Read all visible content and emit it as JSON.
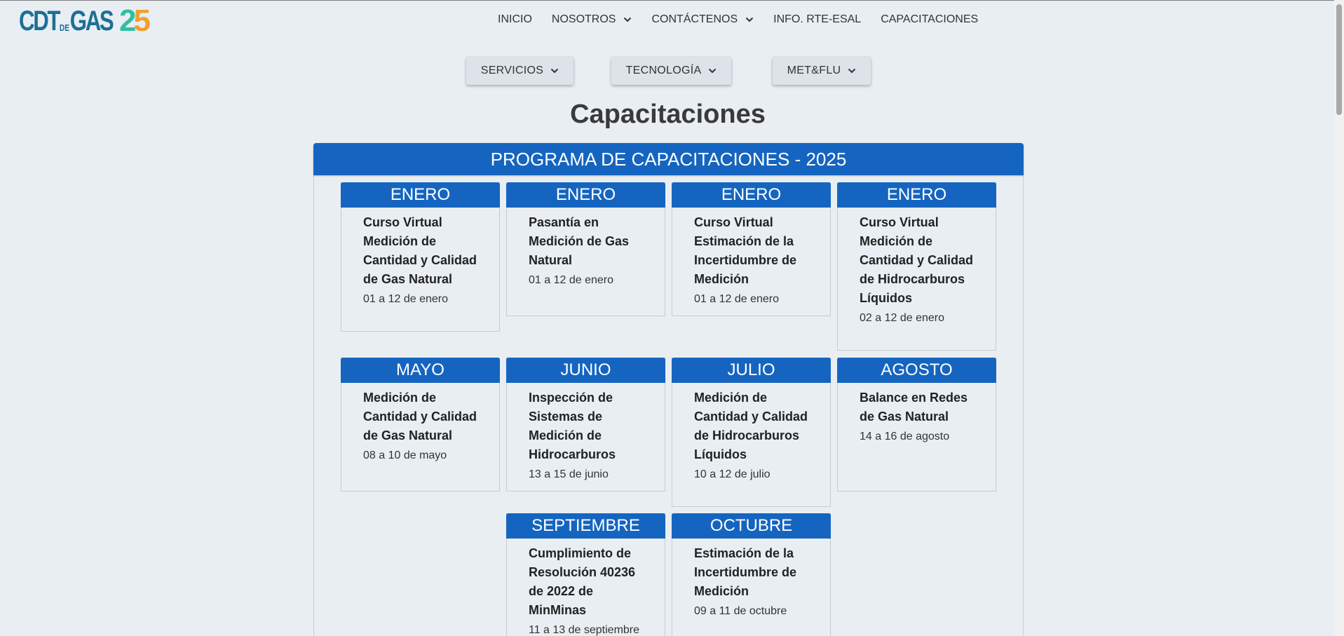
{
  "logo": {
    "text_main": "CDT",
    "text_de": "DE",
    "text_gas": "GAS",
    "text_num_a": "2",
    "text_num_b": "5",
    "colors": {
      "primary": "#1c6f95",
      "teal": "#2fbfa6",
      "orange": "#f0a030"
    }
  },
  "nav": {
    "items": [
      {
        "label": "INICIO",
        "has_dropdown": false
      },
      {
        "label": "NOSOTROS",
        "has_dropdown": true
      },
      {
        "label": "CONTÁCTENOS",
        "has_dropdown": true
      },
      {
        "label": "INFO. RTE-ESAL",
        "has_dropdown": false
      },
      {
        "label": "CAPACITACIONES",
        "has_dropdown": false
      }
    ]
  },
  "dropdowns": [
    {
      "label": "SERVICIOS"
    },
    {
      "label": "TECNOLOGÍA"
    },
    {
      "label": "MET&FLU"
    }
  ],
  "page_title": "Capacitaciones",
  "program_title": "PROGRAMA DE CAPACITACIONES - 2025",
  "colors": {
    "accent": "#1565c0",
    "background": "#e8eef2"
  },
  "courses": [
    {
      "month": "ENERO",
      "title": "Curso Virtual Medición de Cantidad y Calidad de Gas Natural",
      "dates": "01 a 12 de enero"
    },
    {
      "month": "ENERO",
      "title": "Pasantía en Medición de Gas Natural",
      "dates": "01 a 12 de enero"
    },
    {
      "month": "ENERO",
      "title": "Curso Virtual Estimación de la Incertidumbre de Medición",
      "dates": "01 a 12 de enero"
    },
    {
      "month": "ENERO",
      "title": "Curso Virtual Medición de Cantidad y Calidad de Hidrocarburos Líquidos",
      "dates": "02 a 12 de enero"
    },
    {
      "month": "MAYO",
      "title": "Medición de Cantidad y Calidad de Gas Natural",
      "dates": "08 a 10 de mayo"
    },
    {
      "month": "JUNIO",
      "title": "Inspección de Sistemas de Medición de Hidrocarburos",
      "dates": "13 a 15 de junio"
    },
    {
      "month": "JULIO",
      "title": "Medición de Cantidad y Calidad de Hidrocarburos Líquidos",
      "dates": "10 a 12 de julio"
    },
    {
      "month": "AGOSTO",
      "title": "Balance en Redes de Gas Natural",
      "dates": "14 a 16 de agosto"
    },
    {
      "month": "SEPTIEMBRE",
      "title": "Cumplimiento de Resolución 40236 de 2022 de MinMinas",
      "dates": "11 a 13 de septiembre"
    },
    {
      "month": "OCTUBRE",
      "title": "Estimación de la Incertidumbre de Medición",
      "dates": "09 a 11 de octubre"
    }
  ]
}
